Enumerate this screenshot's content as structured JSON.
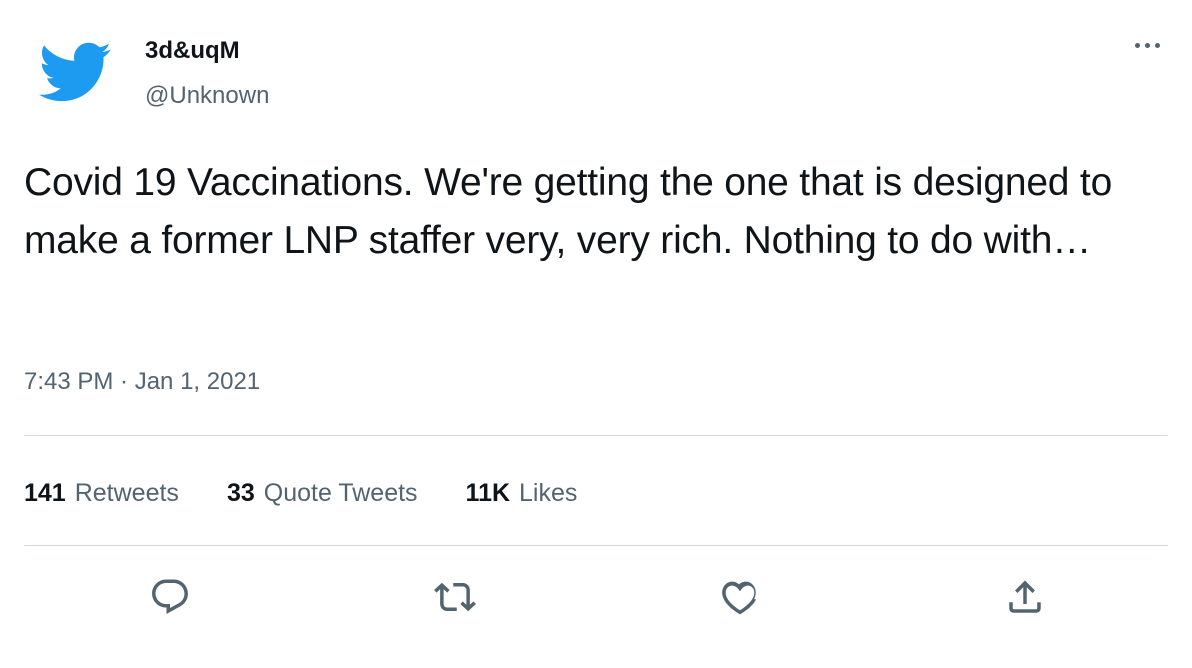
{
  "author": {
    "display_name": "3d&uqM",
    "handle": "@Unknown"
  },
  "tweet": {
    "text": "Covid 19 Vaccinations. We're getting the one that is designed to make a former LNP staffer very, very rich. Nothing to do with…",
    "timestamp": "7:43 PM · Jan 1, 2021"
  },
  "stats": {
    "retweets": {
      "count": "141",
      "label": "Retweets"
    },
    "quote_tweets": {
      "count": "33",
      "label": "Quote Tweets"
    },
    "likes": {
      "count": "11K",
      "label": "Likes"
    }
  },
  "actions": {
    "reply": "reply-icon",
    "retweet": "retweet-icon",
    "like": "like-icon",
    "share": "share-icon"
  },
  "colors": {
    "brand": "#1d9bf0",
    "text": "#0f1419",
    "secondary": "#536471",
    "divider": "#cfd9de"
  }
}
